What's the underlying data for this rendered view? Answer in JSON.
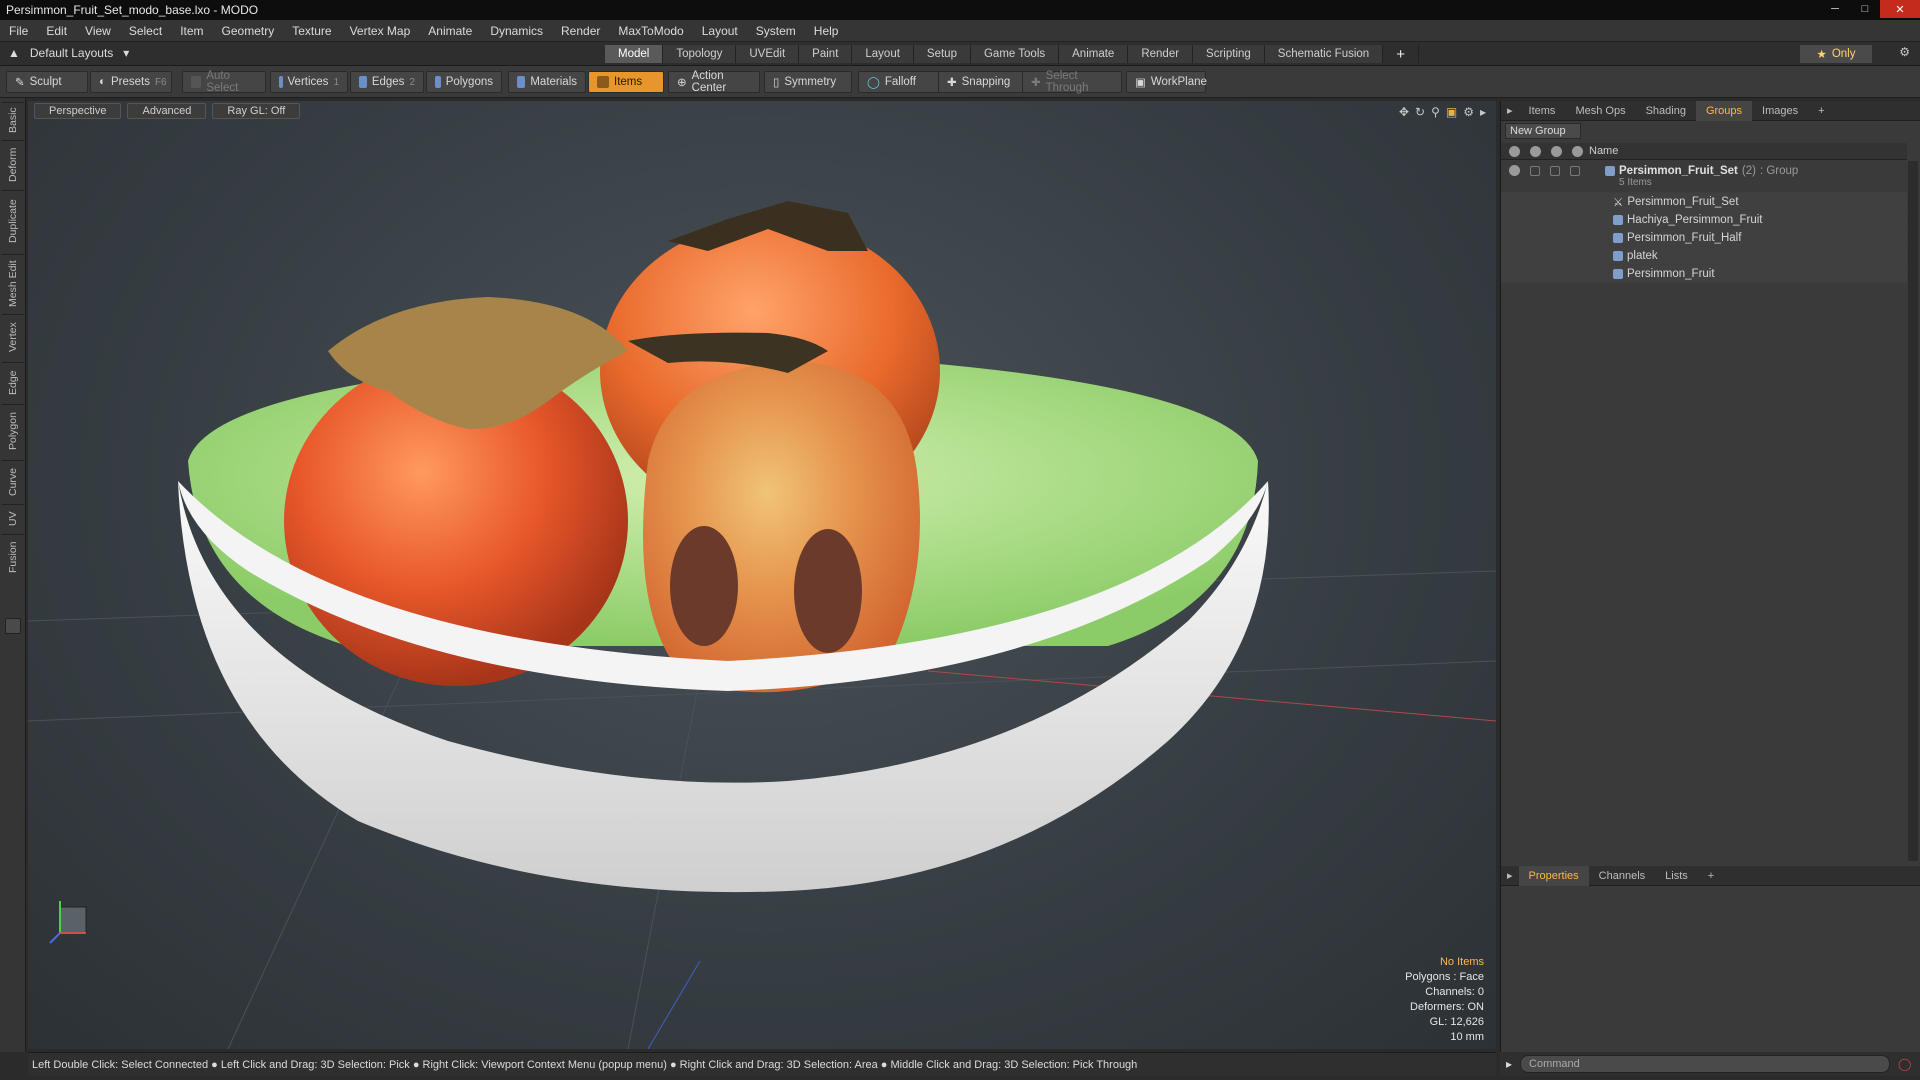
{
  "window": {
    "title": "Persimmon_Fruit_Set_modo_base.lxo - MODO"
  },
  "menu": [
    "File",
    "Edit",
    "View",
    "Select",
    "Item",
    "Geometry",
    "Texture",
    "Vertex Map",
    "Animate",
    "Dynamics",
    "Render",
    "MaxToModo",
    "Layout",
    "System",
    "Help"
  ],
  "layouts": {
    "label": "Default Layouts"
  },
  "tabs": [
    {
      "label": "Model",
      "active": true
    },
    {
      "label": "Topology"
    },
    {
      "label": "UVEdit"
    },
    {
      "label": "Paint"
    },
    {
      "label": "Layout"
    },
    {
      "label": "Setup"
    },
    {
      "label": "Game Tools"
    },
    {
      "label": "Animate"
    },
    {
      "label": "Render"
    },
    {
      "label": "Scripting"
    },
    {
      "label": "Schematic Fusion"
    }
  ],
  "only_label": "Only",
  "toolbar": {
    "sculpt": "Sculpt",
    "presets": "Presets",
    "presets_key": "F6",
    "auto_select": "Auto Select",
    "vertices": "Vertices",
    "vertices_key": "1",
    "edges": "Edges",
    "edges_key": "2",
    "polygons": "Polygons",
    "materials": "Materials",
    "items": "Items",
    "action_center": "Action Center",
    "symmetry": "Symmetry",
    "falloff": "Falloff",
    "snapping": "Snapping",
    "select_through": "Select Through",
    "workplane": "WorkPlane"
  },
  "left_tabs": [
    "Basic",
    "Deform",
    "Duplicate",
    "Mesh Edit",
    "Vertex",
    "Edge",
    "Polygon",
    "Curve",
    "UV",
    "Fusion"
  ],
  "viewport": {
    "view": "Perspective",
    "mode": "Advanced",
    "raygl": "Ray GL: Off",
    "stats": {
      "items": "No Items",
      "polygons": "Polygons : Face",
      "channels": "Channels: 0",
      "deformers": "Deformers: ON",
      "gl": "GL: 12,626",
      "unit": "10 mm"
    }
  },
  "status_text": "Left Double Click: Select Connected ● Left Click and Drag: 3D Selection: Pick ● Right Click: Viewport Context Menu (popup menu) ● Right Click and Drag: 3D Selection: Area ● Middle Click and Drag: 3D Selection: Pick Through",
  "right_tabs": [
    {
      "label": "Items"
    },
    {
      "label": "Mesh Ops"
    },
    {
      "label": "Shading"
    },
    {
      "label": "Groups",
      "active": true
    },
    {
      "label": "Images"
    }
  ],
  "groups": {
    "new_group": "New Group",
    "col_name": "Name",
    "root": {
      "name": "Persimmon_Fruit_Set",
      "count": "(2)",
      "type": ": Group",
      "sub": "5 Items"
    },
    "items": [
      "Persimmon_Fruit_Set",
      "Hachiya_Persimmon_Fruit",
      "Persimmon_Fruit_Half",
      "platek",
      "Persimmon_Fruit"
    ]
  },
  "prop_tabs": [
    {
      "label": "Properties",
      "active": true
    },
    {
      "label": "Channels"
    },
    {
      "label": "Lists"
    }
  ],
  "command_placeholder": "Command"
}
